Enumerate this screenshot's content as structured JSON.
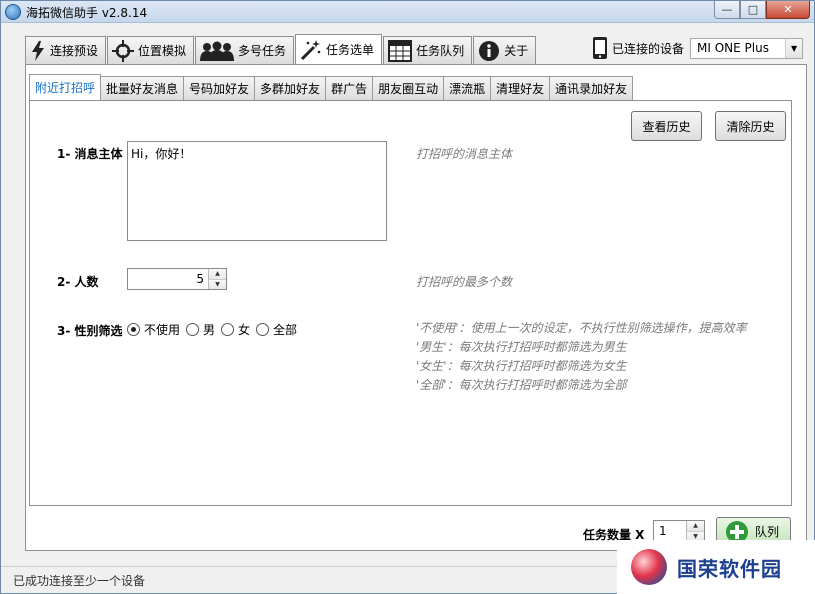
{
  "window": {
    "title": "海拓微信助手 v2.8.14",
    "controls": {
      "minimize": "—",
      "maximize": "□",
      "close": "✕"
    }
  },
  "main_tabs": [
    {
      "label": "连接预设",
      "icon": "lightning-icon"
    },
    {
      "label": "位置模拟",
      "icon": "crosshair-icon"
    },
    {
      "label": "多号任务",
      "icon": "users-icon"
    },
    {
      "label": "任务选单",
      "icon": "magic-wand-icon",
      "active": true
    },
    {
      "label": "任务队列",
      "icon": "table-icon"
    },
    {
      "label": "关于",
      "icon": "info-icon"
    }
  ],
  "device": {
    "label": "已连接的设备",
    "selected": "MI ONE Plus",
    "icon": "phone-icon"
  },
  "sub_tabs": [
    {
      "label": "附近打招呼",
      "active": true
    },
    {
      "label": "批量好友消息"
    },
    {
      "label": "号码加好友"
    },
    {
      "label": "多群加好友"
    },
    {
      "label": "群广告"
    },
    {
      "label": "朋友圈互动"
    },
    {
      "label": "漂流瓶"
    },
    {
      "label": "清理好友"
    },
    {
      "label": "通讯录加好友"
    }
  ],
  "buttons": {
    "view_history": "查看历史",
    "clear_history": "清除历史"
  },
  "form": {
    "message": {
      "label": "1- 消息主体",
      "value": "Hi，你好！",
      "hint": "打招呼的消息主体"
    },
    "count": {
      "label": "2- 人数",
      "value": "5",
      "hint": "打招呼的最多个数"
    },
    "gender": {
      "label": "3- 性别筛选",
      "options": [
        "不使用",
        "男",
        "女",
        "全部"
      ],
      "selected": "不使用",
      "notes": [
        "'不使用'：使用上一次的设定，不执行性别筛选操作，提高效率",
        "'男生'：每次执行打招呼时都筛选为男生",
        "'女生'：每次执行打招呼时都筛选为女生",
        "'全部'：每次执行打招呼时都筛选为全部"
      ]
    }
  },
  "footer": {
    "task_count_label": "任务数量 X",
    "task_count_value": "1",
    "queue_button": "队列"
  },
  "status": "已成功连接至少一个设备",
  "watermark": "国荣软件园",
  "colors": {
    "active_subtab_text": "#1a72c9",
    "hint_text": "#7b7b7b",
    "queue_button_green": "#2f9a3a"
  }
}
